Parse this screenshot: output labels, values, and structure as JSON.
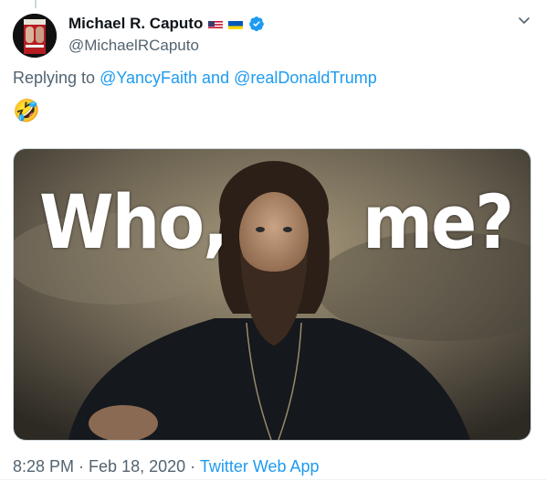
{
  "tweet": {
    "author": {
      "display_name": "Michael R. Caputo",
      "handle": "@MichaelRCaputo",
      "flags": [
        "us-flag-icon",
        "ukraine-flag-icon"
      ],
      "verified": true
    },
    "reply": {
      "prefix": "Replying to ",
      "mention_1": "@YancyFaith",
      "conjunction": " and ",
      "mention_2": "@realDonaldTrump"
    },
    "emoji": "🤣",
    "media": {
      "caption_left": "Who,",
      "caption_right": "me?"
    },
    "meta": {
      "time": "8:28 PM",
      "separator_1": " · ",
      "date": "Feb 18, 2020",
      "separator_2": " · ",
      "source": "Twitter Web App"
    }
  },
  "colors": {
    "accent": "#1d9bf0",
    "secondary_text": "#536471",
    "primary_text": "#0f1419"
  }
}
